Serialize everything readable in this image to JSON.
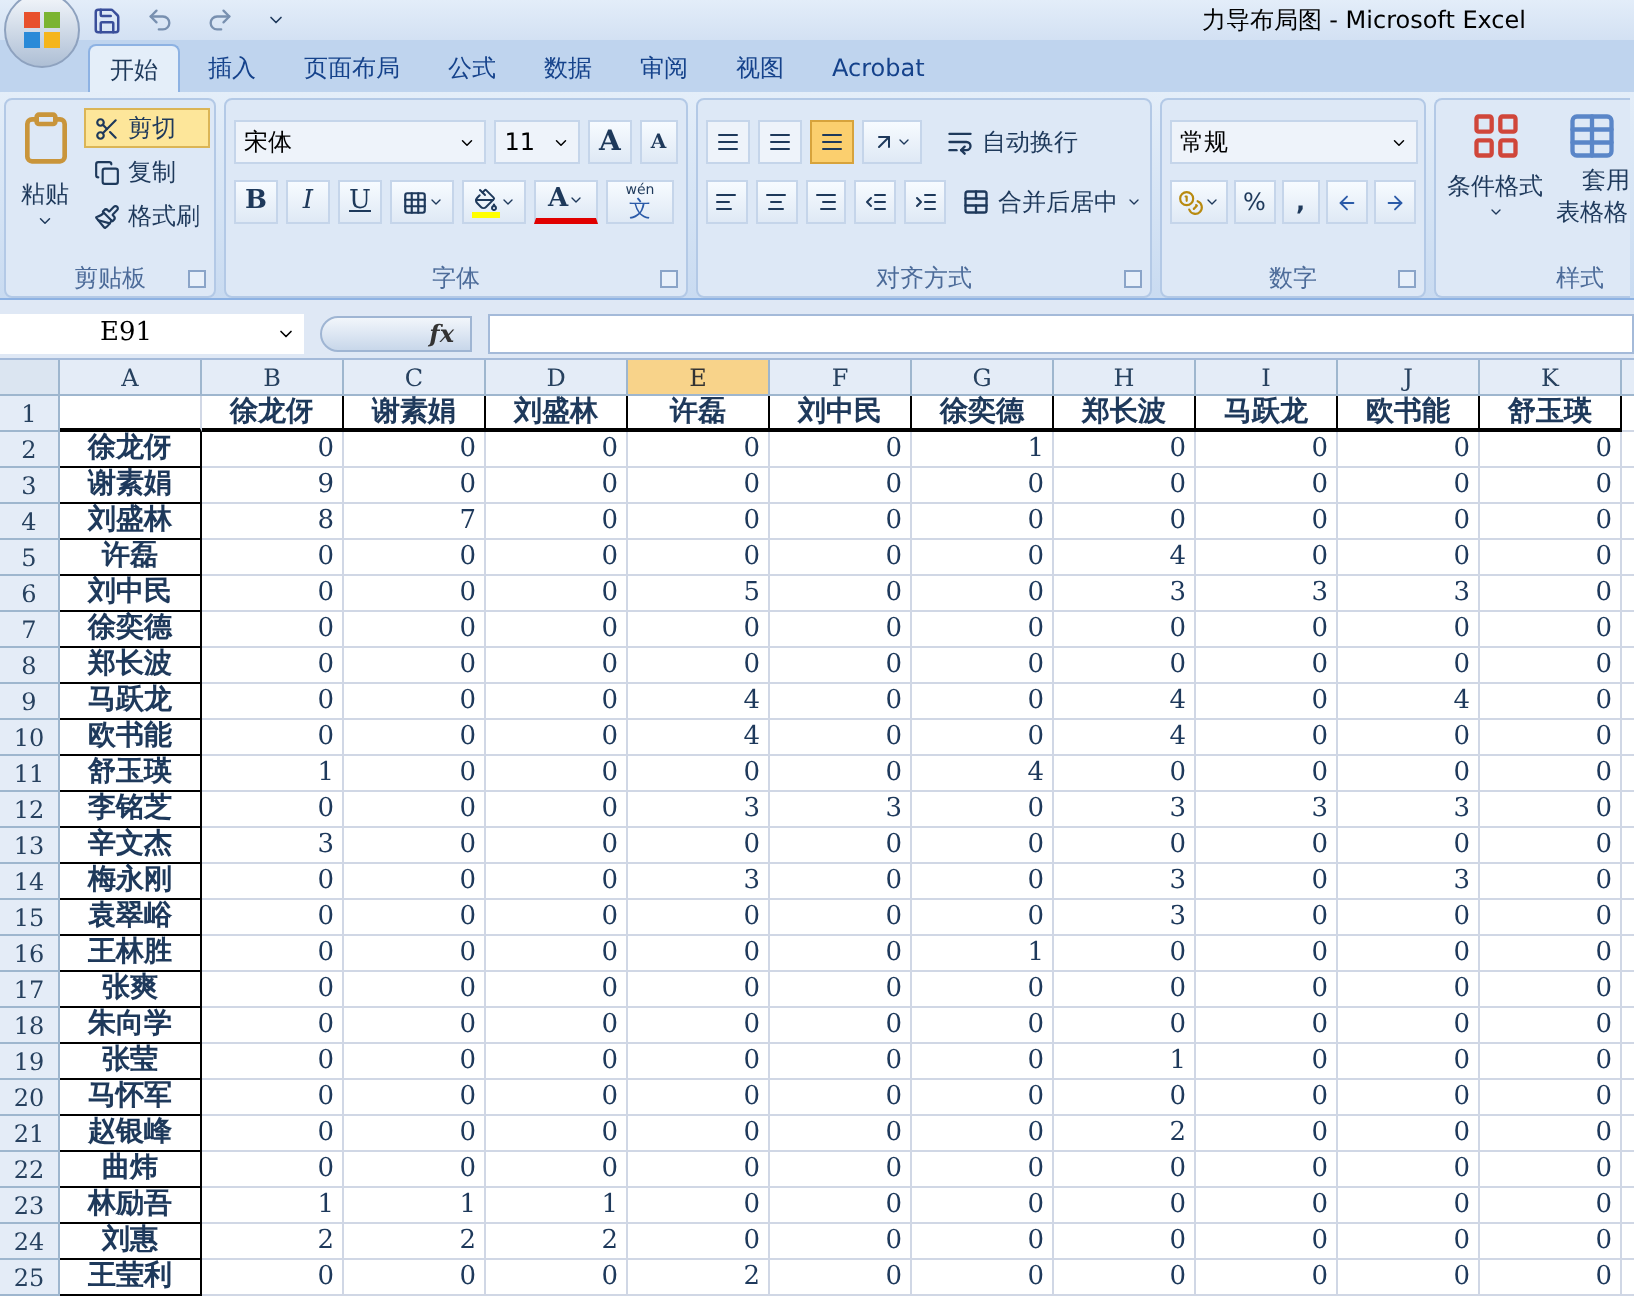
{
  "window": {
    "title": "力导布局图 - Microsoft Excel"
  },
  "tabs": [
    {
      "label": "开始",
      "selected": true
    },
    {
      "label": "插入",
      "selected": false
    },
    {
      "label": "页面布局",
      "selected": false
    },
    {
      "label": "公式",
      "selected": false
    },
    {
      "label": "数据",
      "selected": false
    },
    {
      "label": "审阅",
      "selected": false
    },
    {
      "label": "视图",
      "selected": false
    },
    {
      "label": "Acrobat",
      "selected": false
    }
  ],
  "clipboard": {
    "label": "剪贴板",
    "paste": "粘贴",
    "actions": [
      {
        "label": "剪切",
        "active": true
      },
      {
        "label": "复制",
        "active": false
      },
      {
        "label": "格式刷",
        "active": false
      }
    ]
  },
  "font": {
    "label": "字体",
    "font_name": "宋体",
    "font_size": "11",
    "grow": "A",
    "shrink": "A",
    "styles": [
      "B",
      "I",
      "U"
    ],
    "font_color": "A",
    "phonetic_top": "wén",
    "phonetic": "文"
  },
  "alignment": {
    "label": "对齐方式",
    "vertical": [
      {
        "active": false
      },
      {
        "active": false
      },
      {
        "active": true
      }
    ],
    "wrap": "自动换行",
    "merge": "合并后居中"
  },
  "number": {
    "label": "数字",
    "format": "常规",
    "percent": "%",
    "comma": ","
  },
  "styles": {
    "label": "样式",
    "conditional": "条件格式",
    "table_line1": "套用",
    "table_line2": "表格格"
  },
  "name_box": "E91",
  "fx": "fx",
  "columns": [
    {
      "label": "A",
      "selected": false
    },
    {
      "label": "B",
      "selected": false
    },
    {
      "label": "C",
      "selected": false
    },
    {
      "label": "D",
      "selected": false
    },
    {
      "label": "E",
      "selected": true
    },
    {
      "label": "F",
      "selected": false
    },
    {
      "label": "G",
      "selected": false
    },
    {
      "label": "H",
      "selected": false
    },
    {
      "label": "I",
      "selected": false
    },
    {
      "label": "J",
      "selected": false
    },
    {
      "label": "K",
      "selected": false
    }
  ],
  "header_row": {
    "number": "1",
    "cells": [
      "",
      "徐龙伢",
      "谢素娟",
      "刘盛林",
      "许磊",
      "刘中民",
      "徐奕德",
      "郑长波",
      "马跃龙",
      "欧书能",
      "舒玉瑛"
    ]
  },
  "rows": [
    {
      "number": "2",
      "name": "徐龙伢",
      "values": [
        "0",
        "0",
        "0",
        "0",
        "0",
        "1",
        "0",
        "0",
        "0",
        "0"
      ]
    },
    {
      "number": "3",
      "name": "谢素娟",
      "values": [
        "9",
        "0",
        "0",
        "0",
        "0",
        "0",
        "0",
        "0",
        "0",
        "0"
      ]
    },
    {
      "number": "4",
      "name": "刘盛林",
      "values": [
        "8",
        "7",
        "0",
        "0",
        "0",
        "0",
        "0",
        "0",
        "0",
        "0"
      ]
    },
    {
      "number": "5",
      "name": "许磊",
      "values": [
        "0",
        "0",
        "0",
        "0",
        "0",
        "0",
        "4",
        "0",
        "0",
        "0"
      ]
    },
    {
      "number": "6",
      "name": "刘中民",
      "values": [
        "0",
        "0",
        "0",
        "5",
        "0",
        "0",
        "3",
        "3",
        "3",
        "0"
      ]
    },
    {
      "number": "7",
      "name": "徐奕德",
      "values": [
        "0",
        "0",
        "0",
        "0",
        "0",
        "0",
        "0",
        "0",
        "0",
        "0"
      ]
    },
    {
      "number": "8",
      "name": "郑长波",
      "values": [
        "0",
        "0",
        "0",
        "0",
        "0",
        "0",
        "0",
        "0",
        "0",
        "0"
      ]
    },
    {
      "number": "9",
      "name": "马跃龙",
      "values": [
        "0",
        "0",
        "0",
        "4",
        "0",
        "0",
        "4",
        "0",
        "4",
        "0"
      ]
    },
    {
      "number": "10",
      "name": "欧书能",
      "values": [
        "0",
        "0",
        "0",
        "4",
        "0",
        "0",
        "4",
        "0",
        "0",
        "0"
      ]
    },
    {
      "number": "11",
      "name": "舒玉瑛",
      "values": [
        "1",
        "0",
        "0",
        "0",
        "0",
        "4",
        "0",
        "0",
        "0",
        "0"
      ]
    },
    {
      "number": "12",
      "name": "李铭芝",
      "values": [
        "0",
        "0",
        "0",
        "3",
        "3",
        "0",
        "3",
        "3",
        "3",
        "0"
      ]
    },
    {
      "number": "13",
      "name": "辛文杰",
      "values": [
        "3",
        "0",
        "0",
        "0",
        "0",
        "0",
        "0",
        "0",
        "0",
        "0"
      ]
    },
    {
      "number": "14",
      "name": "梅永刚",
      "values": [
        "0",
        "0",
        "0",
        "3",
        "0",
        "0",
        "3",
        "0",
        "3",
        "0"
      ]
    },
    {
      "number": "15",
      "name": "袁翠峪",
      "values": [
        "0",
        "0",
        "0",
        "0",
        "0",
        "0",
        "3",
        "0",
        "0",
        "0"
      ]
    },
    {
      "number": "16",
      "name": "王林胜",
      "values": [
        "0",
        "0",
        "0",
        "0",
        "0",
        "1",
        "0",
        "0",
        "0",
        "0"
      ]
    },
    {
      "number": "17",
      "name": "张爽",
      "values": [
        "0",
        "0",
        "0",
        "0",
        "0",
        "0",
        "0",
        "0",
        "0",
        "0"
      ]
    },
    {
      "number": "18",
      "name": "朱向学",
      "values": [
        "0",
        "0",
        "0",
        "0",
        "0",
        "0",
        "0",
        "0",
        "0",
        "0"
      ]
    },
    {
      "number": "19",
      "name": "张莹",
      "values": [
        "0",
        "0",
        "0",
        "0",
        "0",
        "0",
        "1",
        "0",
        "0",
        "0"
      ]
    },
    {
      "number": "20",
      "name": "马怀军",
      "values": [
        "0",
        "0",
        "0",
        "0",
        "0",
        "0",
        "0",
        "0",
        "0",
        "0"
      ]
    },
    {
      "number": "21",
      "name": "赵银峰",
      "values": [
        "0",
        "0",
        "0",
        "0",
        "0",
        "0",
        "2",
        "0",
        "0",
        "0"
      ]
    },
    {
      "number": "22",
      "name": "曲炜",
      "values": [
        "0",
        "0",
        "0",
        "0",
        "0",
        "0",
        "0",
        "0",
        "0",
        "0"
      ]
    },
    {
      "number": "23",
      "name": "林励吾",
      "values": [
        "1",
        "1",
        "1",
        "0",
        "0",
        "0",
        "0",
        "0",
        "0",
        "0"
      ]
    },
    {
      "number": "24",
      "name": "刘惠",
      "values": [
        "2",
        "2",
        "2",
        "0",
        "0",
        "0",
        "0",
        "0",
        "0",
        "0"
      ]
    },
    {
      "number": "25",
      "name": "王莹利",
      "values": [
        "0",
        "0",
        "0",
        "2",
        "0",
        "0",
        "0",
        "0",
        "0",
        "0"
      ]
    }
  ]
}
